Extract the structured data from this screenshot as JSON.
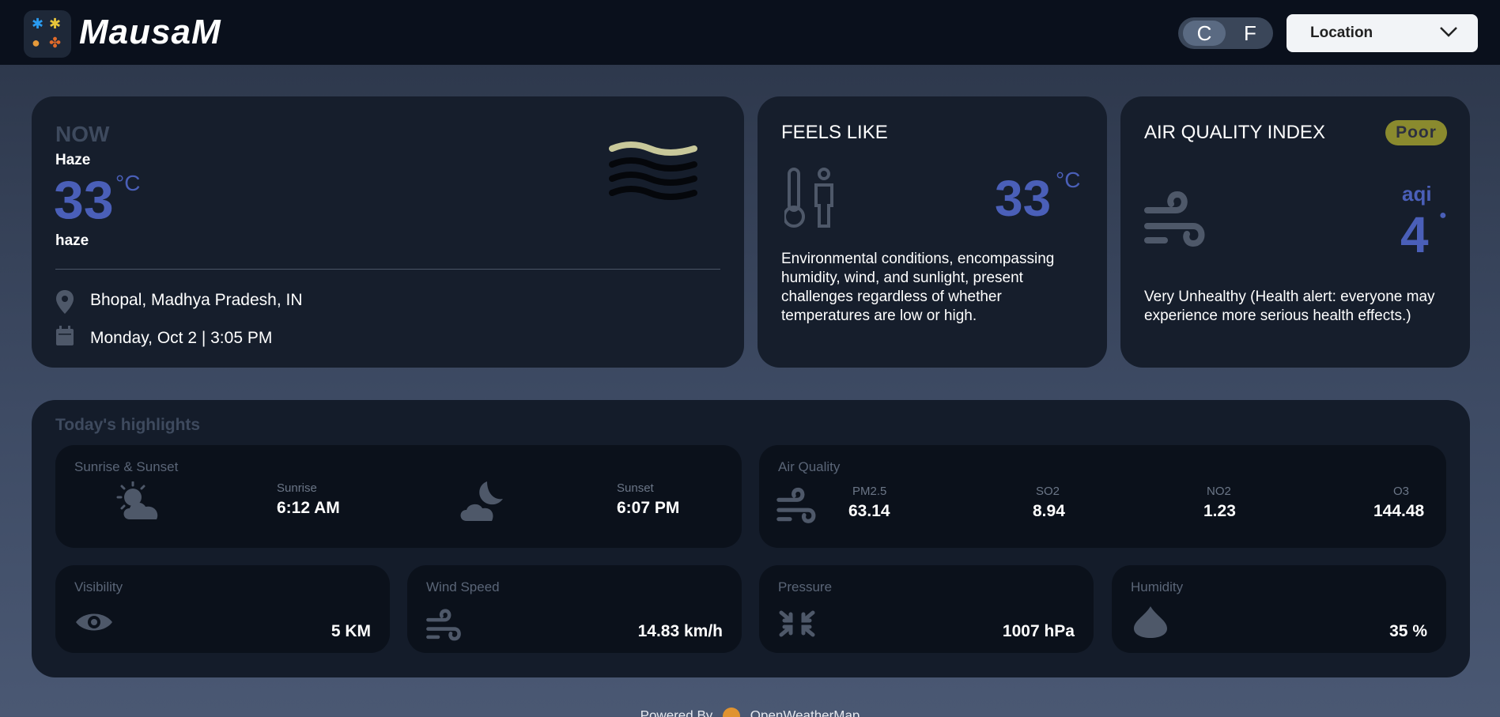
{
  "app": {
    "brand": "MausaM"
  },
  "header": {
    "units": [
      "C",
      "F"
    ],
    "active_unit": "C",
    "location_label": "Location"
  },
  "now": {
    "heading": "NOW",
    "condition_title": "Haze",
    "temp": "33",
    "temp_unit": "°C",
    "description": "haze",
    "location": "Bhopal, Madhya Pradesh, IN",
    "datetime": "Monday, Oct 2 | 3:05 PM"
  },
  "feels": {
    "heading": "FEELS LIKE",
    "temp": "33",
    "temp_unit": "°C",
    "description": "Environmental conditions, encompassing humidity, wind, and sunlight, present challenges regardless of whether temperatures are low or high."
  },
  "aqi": {
    "heading": "AIR QUALITY INDEX",
    "badge": "Poor",
    "unit_label": "aqi",
    "value": "4",
    "description": "Very Unhealthy (Health alert: everyone may experience more serious health effects.)"
  },
  "highlights": {
    "heading": "Today's highlights",
    "sun": {
      "title": "Sunrise & Sunset",
      "sunrise_label": "Sunrise",
      "sunrise_value": "6:12 AM",
      "sunset_label": "Sunset",
      "sunset_value": "6:07 PM"
    },
    "air": {
      "title": "Air Quality",
      "items": [
        {
          "label": "PM2.5",
          "value": "63.14"
        },
        {
          "label": "SO2",
          "value": "8.94"
        },
        {
          "label": "NO2",
          "value": "1.23"
        },
        {
          "label": "O3",
          "value": "144.48"
        }
      ]
    },
    "visibility": {
      "title": "Visibility",
      "value": "5 KM"
    },
    "wind": {
      "title": "Wind Speed",
      "value": "14.83 km/h"
    },
    "pressure": {
      "title": "Pressure",
      "value": "1007 hPa"
    },
    "humidity": {
      "title": "Humidity",
      "value": "35 %"
    }
  },
  "footer": {
    "powered_by": "Powered By",
    "provider": "OpenWeatherMap"
  },
  "colors": {
    "accent_blue": "#4a5fb8",
    "badge_bg": "#8a8a2e",
    "card_bg": "#161e2c"
  }
}
